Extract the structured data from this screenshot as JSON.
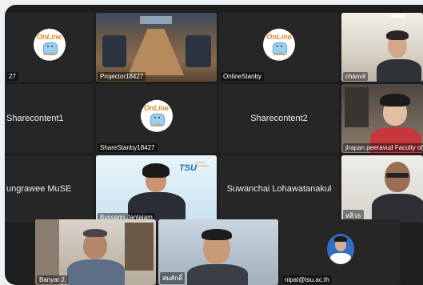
{
  "tiles": {
    "t1": {
      "label": "27"
    },
    "t2": {
      "label": "Projector18427"
    },
    "t3": {
      "label": "OnlineStanby"
    },
    "t4": {
      "label": "chanvit"
    },
    "t5": {
      "label": "Sharecontent1"
    },
    "t6": {
      "label": "ShareStanby18427"
    },
    "t7": {
      "label": "Sharecontent2"
    },
    "t8": {
      "label": "jirapan peeravud Faculty of M"
    },
    "t9": {
      "label": "ungrawee MuSE"
    },
    "t10": {
      "label": "Bussarin Jantajam"
    },
    "t11": {
      "label": "Suwanchai Lohawatanakul"
    },
    "t12": {
      "label": "หลิวธ"
    },
    "t13": {
      "label": "Banyat J."
    },
    "t14": {
      "label": "สมศักดิ์"
    },
    "t15": {
      "label": "nipat@tsu.ac.th"
    }
  },
  "logo": {
    "title": "OnLine",
    "sub": "งานสื่อ"
  },
  "brand": {
    "tsu": "TSU",
    "tsu_sub": "THAKSIN UNIVERSITY"
  },
  "colors": {
    "active_border": "#4cd37a",
    "tile_bg": "#2a2a2a",
    "window_bg": "#1e1e1e"
  }
}
